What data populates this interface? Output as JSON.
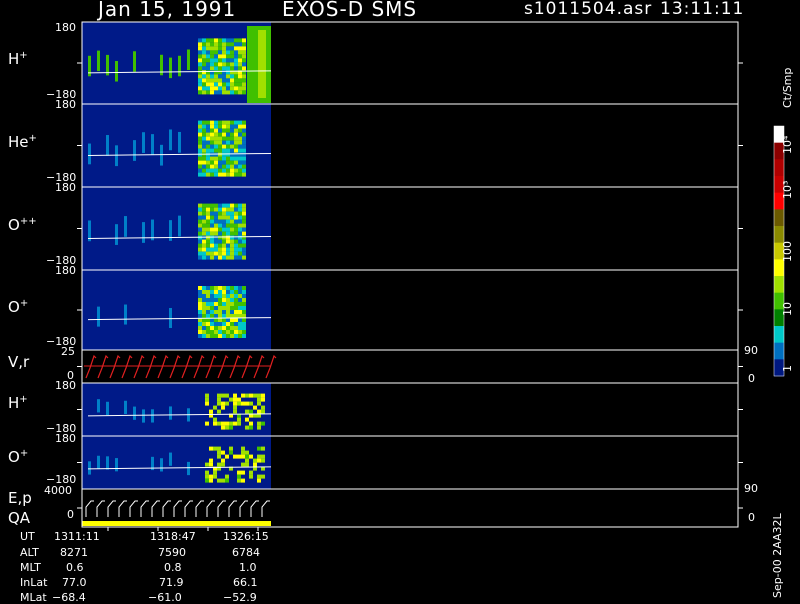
{
  "header": {
    "date": "Jan 15, 1991",
    "instrument": "EXOS-D SMS",
    "filename": "s1011504.asr",
    "time": "13:11:11"
  },
  "panels": [
    {
      "label": "H",
      "sup": "+",
      "ymax": "180",
      "ymin": "−180"
    },
    {
      "label": "He",
      "sup": "+",
      "ymax": "180",
      "ymin": "−180"
    },
    {
      "label": "O",
      "sup": "++",
      "ymax": "180",
      "ymin": "−180"
    },
    {
      "label": "O",
      "sup": "+",
      "ymax": "180",
      "ymin": "−180"
    },
    {
      "label": "V,r",
      "sup": "",
      "ymax": "25",
      "ymin": "0",
      "right_top": "90",
      "right_bottom": "0"
    },
    {
      "label": "H",
      "sup": "+",
      "ymax": "180",
      "ymin": "−180"
    },
    {
      "label": "O",
      "sup": "+",
      "ymax": "180",
      "ymin": "−180"
    },
    {
      "label": "E,p",
      "label2": "QA",
      "ymax": "4000",
      "ymin": "0",
      "right_top": "90",
      "right_bottom": "0"
    }
  ],
  "colorbar": {
    "unit": "Ct/Smp",
    "ticks": [
      "10⁴",
      "10³",
      "100",
      "10",
      "1"
    ],
    "colors": [
      "#ffffff",
      "#8b0000",
      "#b00000",
      "#c80000",
      "#ff0000",
      "#6b5a00",
      "#8a8a00",
      "#c8c800",
      "#ffff00",
      "#a0e000",
      "#40c000",
      "#008000",
      "#00c8c8",
      "#0070c0",
      "#001880"
    ]
  },
  "footer": {
    "rows": [
      {
        "label": "UT",
        "values": [
          "1311:11",
          "1318:47",
          "1326:15"
        ]
      },
      {
        "label": "ALT",
        "values": [
          "8271",
          "7590",
          "6784"
        ]
      },
      {
        "label": "MLT",
        "values": [
          "0.6",
          "0.8",
          "1.0"
        ]
      },
      {
        "label": "InLat",
        "values": [
          "77.0",
          "71.9",
          "66.1"
        ]
      },
      {
        "label": "MLat",
        "values": [
          "−68.4",
          "−61.0",
          "−52.9"
        ]
      }
    ],
    "version": "Sep-00 2AA32L"
  }
}
